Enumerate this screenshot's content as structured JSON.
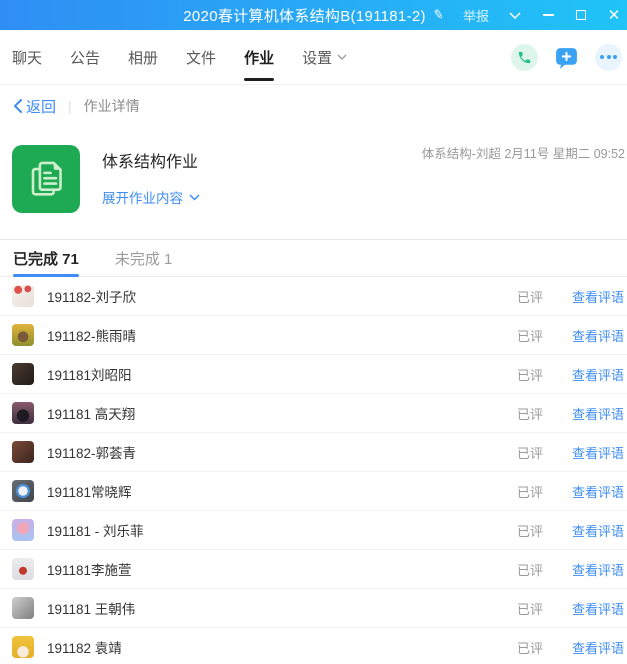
{
  "titlebar": {
    "title": "2020春计算机体系结构B(191181-2)",
    "report_label": "举报",
    "bg_left": "#2f8ef4",
    "bg_right": "#20c4f7"
  },
  "icons": {
    "edit": "✎",
    "close": "✕"
  },
  "nav": {
    "tabs": [
      {
        "label": "聊天"
      },
      {
        "label": "公告"
      },
      {
        "label": "相册"
      },
      {
        "label": "文件"
      },
      {
        "label": "作业"
      },
      {
        "label": "设置"
      }
    ],
    "phone_color": "#26bf8e",
    "plus_bubble_color": "#3aa2f5",
    "accent": "#3d8df5"
  },
  "breadcrumb": {
    "back_label": "返回",
    "divider": "|",
    "title": "作业详情"
  },
  "assignment": {
    "title": "体系结构作业",
    "expand_label": "展开作业内容",
    "meta": "体系结构-刘超 2月11号 星期二 09:52",
    "icon_color": "#1ea953"
  },
  "status_tabs": {
    "completed": "已完成 71",
    "incomplete": "未完成 1"
  },
  "row_labels": {
    "status": "已评",
    "action": "查看评语"
  },
  "students": [
    {
      "name": "191182-刘子欣",
      "avatar_css": "background:radial-gradient(circle at 28% 22%, #e0514d 0 16%, transparent 18%), radial-gradient(circle at 72% 18%, #d94f4f 0 13%, transparent 15%), linear-gradient(135deg,#f7f3f0,#e6ded7)"
    },
    {
      "name": "191182-熊雨晴",
      "avatar_css": "background:radial-gradient(circle at 50% 58%, #7a5a3a 0 30%, transparent 33%), linear-gradient(180deg,#e0b33c,#8f8f2e)"
    },
    {
      "name": "191181刘昭阳",
      "avatar_css": "background:linear-gradient(135deg,#4a3b33,#221a16)"
    },
    {
      "name": "191181 高天翔",
      "avatar_css": "background:radial-gradient(circle at 50% 62%, #1d1a22 0 34%, transparent 37%), linear-gradient(180deg,#8a5a6a,#3c2f3e)"
    },
    {
      "name": "191182-郭荟青",
      "avatar_css": "background:linear-gradient(135deg,#7a4a3a,#3c241e)"
    },
    {
      "name": "191181常晓辉",
      "avatar_css": "background:radial-gradient(circle at 50% 50%, #eef1f3 0 30%, #4a90d9 31% 44%, transparent 46%), linear-gradient(135deg,#6a6f76,#3f444b)"
    },
    {
      "name": "191181 - 刘乐菲",
      "avatar_css": "background:radial-gradient(circle at 50% 42%, #f2a7b8 0 34%, transparent 37%), linear-gradient(180deg,#c9aee8,#a8c4ef)"
    },
    {
      "name": "191181李施萱",
      "avatar_css": "background:radial-gradient(circle at 50% 58%, #c0392b 0 22%, transparent 25%), linear-gradient(180deg,#ececee,#dcdce2)"
    },
    {
      "name": "191181 王朝伟",
      "avatar_css": "background:linear-gradient(135deg,#cfcfcf,#7f7f7f)"
    },
    {
      "name": "191182 袁靖",
      "avatar_css": "background:radial-gradient(circle at 50% 72%, #f9ecdb 0 28%, transparent 31%), linear-gradient(180deg,#f0c23c,#e6b02c)"
    }
  ]
}
